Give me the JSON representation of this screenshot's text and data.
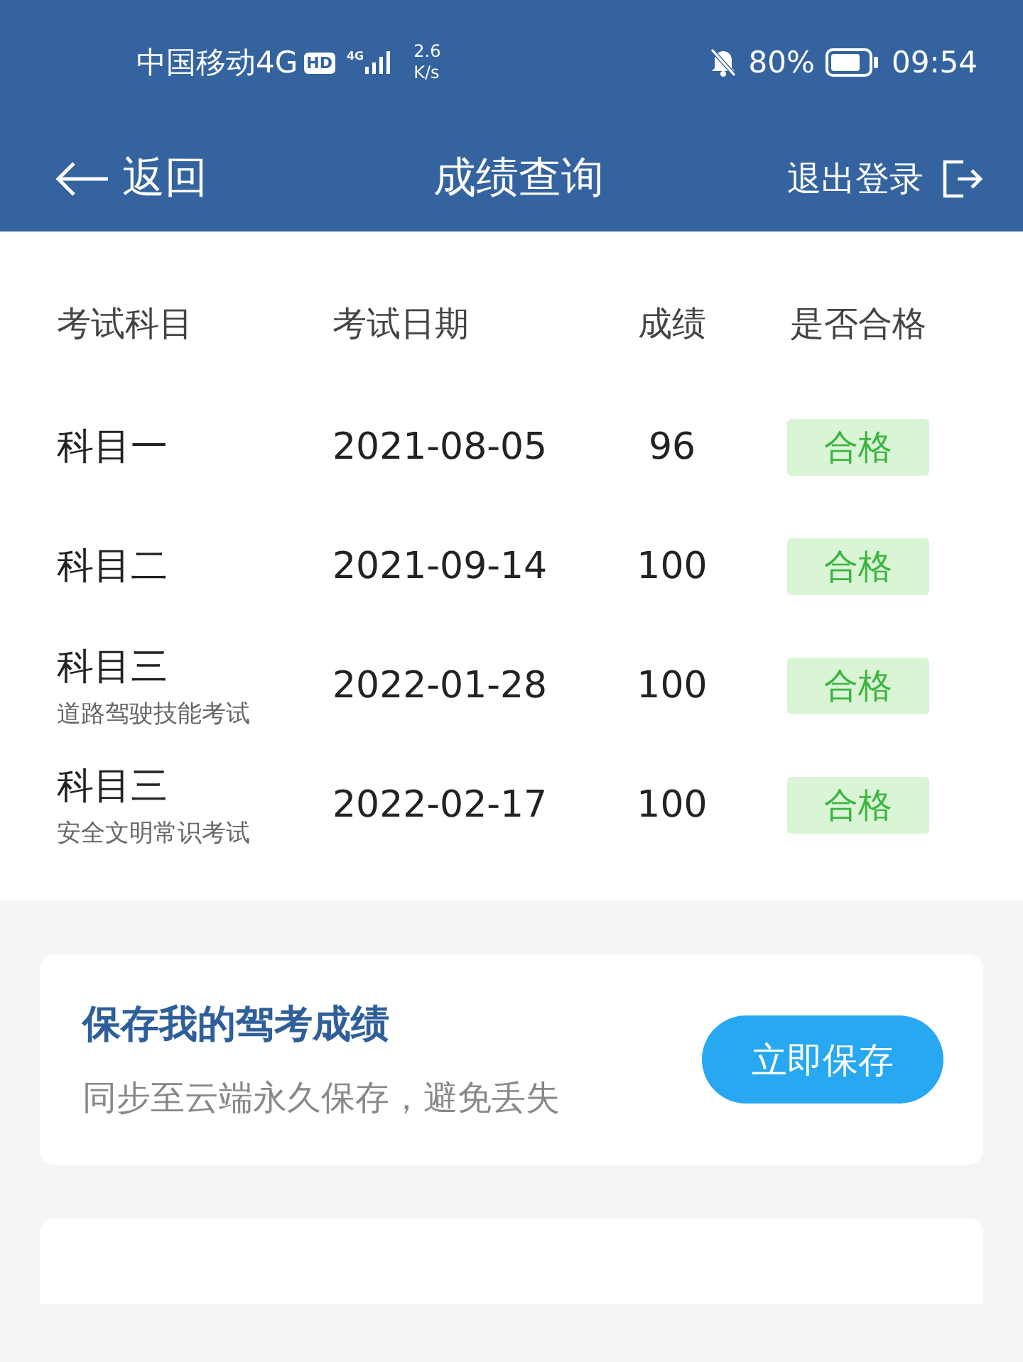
{
  "status_bar": {
    "carrier": "中国移动4G",
    "hd": "HD",
    "network_type": "4G",
    "speed_value": "2.6",
    "speed_unit": "K/s",
    "muted": true,
    "battery": "80%",
    "time": "09:54"
  },
  "nav": {
    "back": "返回",
    "title": "成绩查询",
    "logout": "退出登录"
  },
  "table": {
    "columns": [
      "考试科目",
      "考试日期",
      "成绩",
      "是否合格"
    ],
    "rows": [
      {
        "subject": "科目一",
        "date": "2021-08-05",
        "score": "96",
        "result": "合格",
        "passed": true
      },
      {
        "subject": "科目二",
        "date": "2021-09-14",
        "score": "100",
        "result": "合格",
        "passed": true
      },
      {
        "subject": "科目三",
        "note": "道路驾驶技能考试",
        "date": "2022-01-28",
        "score": "100",
        "result": "合格",
        "passed": true
      },
      {
        "subject": "科目三",
        "note": "安全文明常识考试",
        "date": "2022-02-17",
        "score": "100",
        "result": "合格",
        "passed": true
      }
    ]
  },
  "save_card": {
    "title": "保存我的驾考成绩",
    "subtitle": "同步至云端永久保存，避免丢失",
    "button": "立即保存"
  }
}
